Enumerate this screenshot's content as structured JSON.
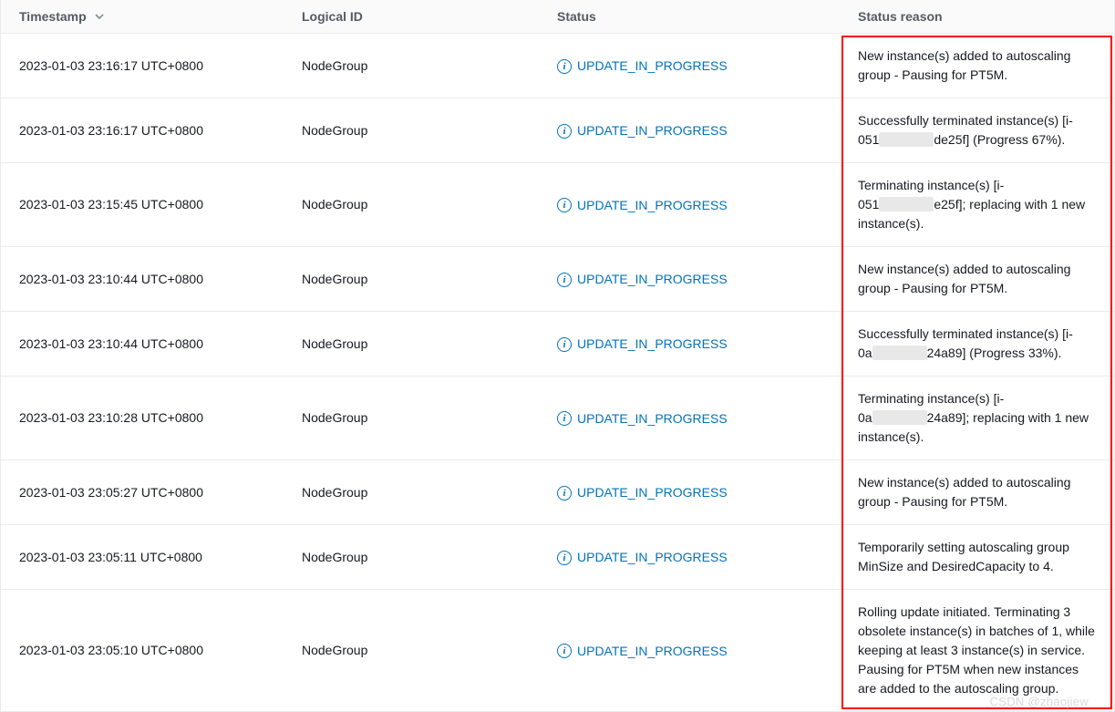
{
  "headers": {
    "timestamp": "Timestamp",
    "logical_id": "Logical ID",
    "status": "Status",
    "status_reason": "Status reason"
  },
  "rows": [
    {
      "timestamp": "2023-01-03 23:16:17 UTC+0800",
      "logical_id": "NodeGroup",
      "status": "UPDATE_IN_PROGRESS",
      "reason": "New instance(s) added to autoscaling group - Pausing for PT5M."
    },
    {
      "timestamp": "2023-01-03 23:16:17 UTC+0800",
      "logical_id": "NodeGroup",
      "status": "UPDATE_IN_PROGRESS",
      "reason_parts": [
        "Successfully terminated instance(s) [i-051",
        "de25f] (Progress 67%)."
      ],
      "obscured": true
    },
    {
      "timestamp": "2023-01-03 23:15:45 UTC+0800",
      "logical_id": "NodeGroup",
      "status": "UPDATE_IN_PROGRESS",
      "reason_parts": [
        "Terminating instance(s) [i-051",
        "e25f]; replacing with 1 new instance(s)."
      ],
      "obscured": true
    },
    {
      "timestamp": "2023-01-03 23:10:44 UTC+0800",
      "logical_id": "NodeGroup",
      "status": "UPDATE_IN_PROGRESS",
      "reason": "New instance(s) added to autoscaling group - Pausing for PT5M."
    },
    {
      "timestamp": "2023-01-03 23:10:44 UTC+0800",
      "logical_id": "NodeGroup",
      "status": "UPDATE_IN_PROGRESS",
      "reason_parts": [
        "Successfully terminated instance(s) [i-0a",
        "24a89] (Progress 33%)."
      ],
      "obscured": true
    },
    {
      "timestamp": "2023-01-03 23:10:28 UTC+0800",
      "logical_id": "NodeGroup",
      "status": "UPDATE_IN_PROGRESS",
      "reason_parts": [
        "Terminating instance(s) [i-0a",
        "24a89]; replacing with 1 new instance(s)."
      ],
      "obscured": true
    },
    {
      "timestamp": "2023-01-03 23:05:27 UTC+0800",
      "logical_id": "NodeGroup",
      "status": "UPDATE_IN_PROGRESS",
      "reason": "New instance(s) added to autoscaling group - Pausing for PT5M."
    },
    {
      "timestamp": "2023-01-03 23:05:11 UTC+0800",
      "logical_id": "NodeGroup",
      "status": "UPDATE_IN_PROGRESS",
      "reason": "Temporarily setting autoscaling group MinSize and DesiredCapacity to 4."
    },
    {
      "timestamp": "2023-01-03 23:05:10 UTC+0800",
      "logical_id": "NodeGroup",
      "status": "UPDATE_IN_PROGRESS",
      "reason": "Rolling update initiated. Terminating 3 obsolete instance(s) in batches of 1, while keeping at least 3 instance(s) in service. Pausing for PT5M when new instances are added to the autoscaling group."
    }
  ],
  "watermark": "CSDN @zhaojiew"
}
